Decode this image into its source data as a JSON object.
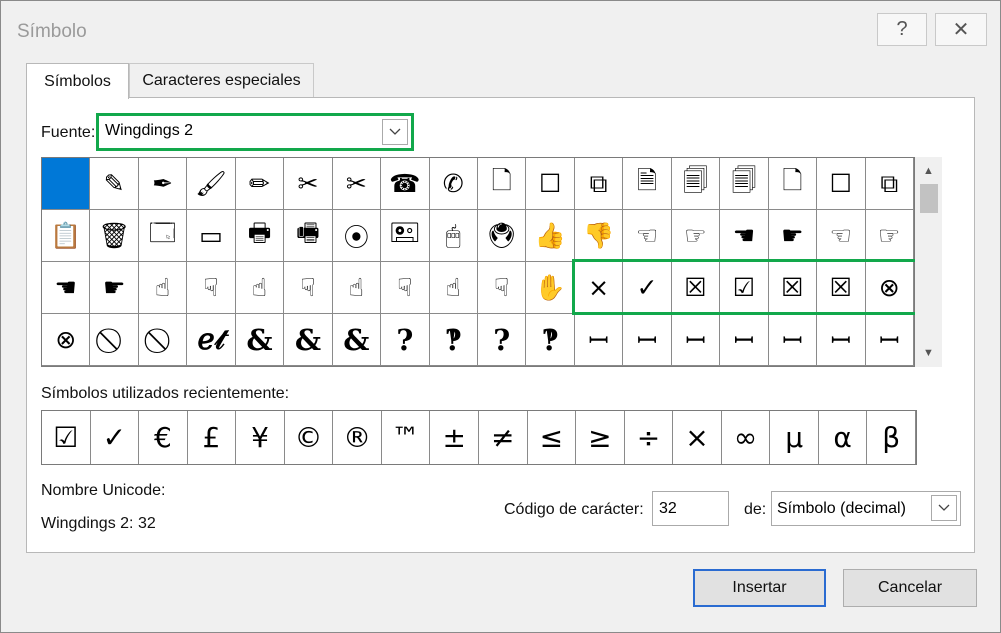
{
  "window": {
    "title": "Símbolo",
    "help_label": "?",
    "close_label": "✕"
  },
  "tabs": [
    {
      "label": "Símbolos",
      "active": true
    },
    {
      "label": "Caracteres especiales",
      "active": false
    }
  ],
  "font": {
    "label": "Fuente:",
    "value": "Wingdings 2"
  },
  "symbols": [
    [
      "",
      "✎",
      "✒",
      "🖌",
      "✏",
      "✂",
      "✂",
      "☎",
      "✆",
      "🗋",
      "☐",
      "⧉",
      "🗎",
      "🗐",
      "🗐",
      "🗋",
      "☐",
      "⧉"
    ],
    [
      "📋",
      "🗑",
      "🗔",
      "▭",
      "🖶",
      "🖷",
      "⦿",
      "🖭",
      "🖱",
      "🖲",
      "👍",
      "👎",
      "☜",
      "☞",
      "☚",
      "☛",
      "☜",
      "☞"
    ],
    [
      "☚",
      "☛",
      "☝",
      "☟",
      "☝",
      "☟",
      "☝",
      "☟",
      "☝",
      "☟",
      "✋",
      "×",
      "✓",
      "☒",
      "☑",
      "☒",
      "☒",
      "⊗"
    ],
    [
      "⊗",
      "⃠",
      "⃠",
      "ℯ𝓉",
      "&",
      "&",
      "&",
      "?",
      "‽",
      "?",
      "‽",
      "ꟷ",
      "ꟷ",
      "ꟷ",
      "ꟷ",
      "ꟷ",
      "ꟷ",
      "ꟷ"
    ]
  ],
  "recent": {
    "label": "Símbolos utilizados recientemente:",
    "symbols": [
      "☑",
      "✓",
      "€",
      "£",
      "¥",
      "©",
      "®",
      "™",
      "±",
      "≠",
      "≤",
      "≥",
      "÷",
      "×",
      "∞",
      "µ",
      "α",
      "β"
    ]
  },
  "unicode": {
    "name_label": "Nombre Unicode:",
    "name_value": "Wingdings 2: 32"
  },
  "char_code": {
    "label": "Código de carácter:",
    "value": "32"
  },
  "from": {
    "label": "de:",
    "value": "Símbolo (decimal)"
  },
  "buttons": {
    "insert": "Insertar",
    "cancel": "Cancelar"
  },
  "colors": {
    "highlight": "#12a84b",
    "selected": "#0078d7"
  }
}
